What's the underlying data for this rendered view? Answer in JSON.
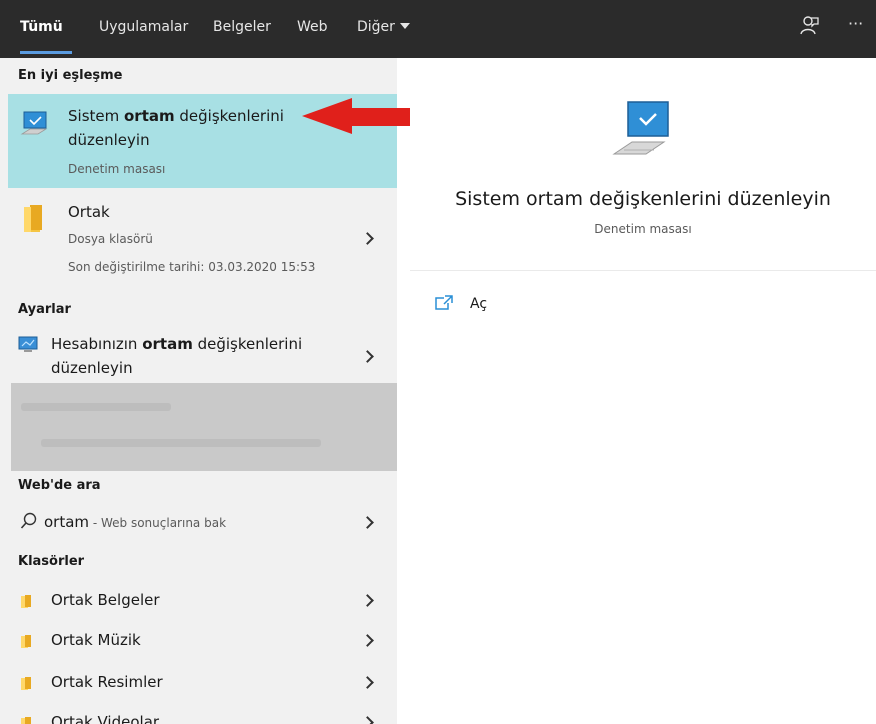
{
  "tabs": [
    {
      "label": "Tümü"
    },
    {
      "label": "Uygulamalar"
    },
    {
      "label": "Belgeler"
    },
    {
      "label": "Web"
    },
    {
      "label": "Diğer"
    }
  ],
  "top_right": {
    "feedback_icon": "feedback-icon",
    "more_label": "···"
  },
  "sections": {
    "best_match": "En iyi eşleşme",
    "settings": "Ayarlar",
    "web": "Web'de ara",
    "folders": "Klasörler"
  },
  "best_match": {
    "title_before": "Sistem ",
    "title_bold": "ortam",
    "title_after": " değişkenlerini",
    "title_line2": "düzenleyin",
    "subtitle": "Denetim masası"
  },
  "folder_result": {
    "title": "Ortak",
    "type": "Dosya klasörü",
    "modified": "Son değiştirilme tarihi: 03.03.2020 15:53"
  },
  "setting_result": {
    "title_before": "Hesabınızın ",
    "title_bold": "ortam",
    "title_after": " değişkenlerini",
    "title_line2": "düzenleyin"
  },
  "web_result": {
    "query": "ortam",
    "hint": " - Web sonuçlarına bak"
  },
  "folders": [
    {
      "label": "Ortak Belgeler"
    },
    {
      "label": "Ortak Müzik"
    },
    {
      "label": "Ortak Resimler"
    },
    {
      "label": "Ortak Videolar"
    }
  ],
  "preview": {
    "title": "Sistem ortam değişkenlerini düzenleyin",
    "subtitle": "Denetim masası",
    "action_open": "Aç"
  },
  "colors": {
    "topbar": "#2b2b2b",
    "selected_row": "#a8e0e4",
    "arrow": "#e0201b"
  }
}
